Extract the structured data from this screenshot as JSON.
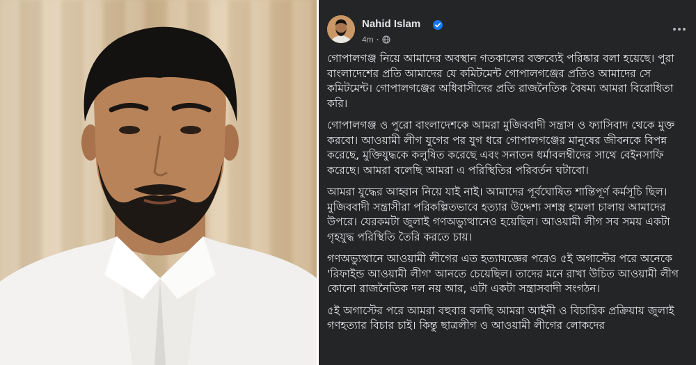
{
  "post": {
    "author": "Nahid Islam",
    "timestamp": "4m",
    "icons": {
      "verified": "verified-badge-icon",
      "audience": "globe-icon",
      "menu": "more-options-icon"
    },
    "paragraphs": [
      "গোপালগঞ্জ নিয়ে আমাদের অবস্থান গতকালের বক্তব্যেই পরিষ্কার বলা হয়েছে। পুরা বাংলাদেশের প্রতি আমাদের যে কমিটমেন্ট গোপালগঞ্জের প্রতিও আমাদের সে কমিটমেন্ট। গোপালগঞ্জের অধিবাসীদের প্রতি রাজনৈতিক বৈষম্য আমরা বিরোধিতা করি।",
      "গোপালগঞ্জ ও পুরো বাংলাদেশকে আমরা মুজিববাদী সন্ত্রাস ও ফ্যাসিবাদ থেকে মুক্ত করবো। আওয়ামী লীগ যুগের পর যুগ ধরে গোপালগঞ্জের মানুষের জীবনকে বিপন্ন করেছে, মুক্তিযুদ্ধকে কলুষিত করেছে এবং সনাতন ধর্মাবলম্বীদের সাথে বেইনসাফি করেছে। আমরা বলেছি আমরা এ পরিস্থিতির পরিবর্তন ঘটাবো।",
      "আমরা যুদ্ধের আহ্বান নিয়ে যাই নাই। আমাদের পূর্বঘোষিত শান্তিপূর্ণ কর্মসূচি ছিল। মুজিববাদী সন্ত্রাসীরা পরিকল্পিতভাবে হত্যার উদ্দেশ্য সশস্ত্র হামলা চালায় আমাদের উপরে। যেরকমটা জুলাই গণঅভ্যুত্থানেও হয়েছিল। আওয়ামী লীগ সব সময় একটা গৃহযুদ্ধ পরিস্থিতি তৈরি করতে চায়।",
      "গণঅভ্যুত্থানে আওয়ামী লীগের এত হত্যাযজ্ঞের পরেও ৫ই অগাস্টের পরে অনেকে 'রিফাইন্ড আওয়ামী লীগ' আনতে চেয়েছিল। তাদের মনে রাখা উচিত আওয়ামী লীগ কোনো রাজনৈতিক দল নয় আর, এটা একটা সন্ত্রাসবাদী সংগঠন।",
      "৫ই অগাস্টের পরে আমরা বহুবার বলছি আমরা আইনী ও বিচারিক প্রক্রিয়ায় জুলাই গণহত্যার বিচার চাই। কিন্তু ছাত্রলীগ ও আওয়ামী লীগের লোকদের"
    ]
  },
  "colors": {
    "page_background": "#18191a",
    "card_background": "#242526",
    "primary_text": "#e4e6eb",
    "secondary_text": "#b0b3b8",
    "verified_blue": "#1877f2"
  }
}
